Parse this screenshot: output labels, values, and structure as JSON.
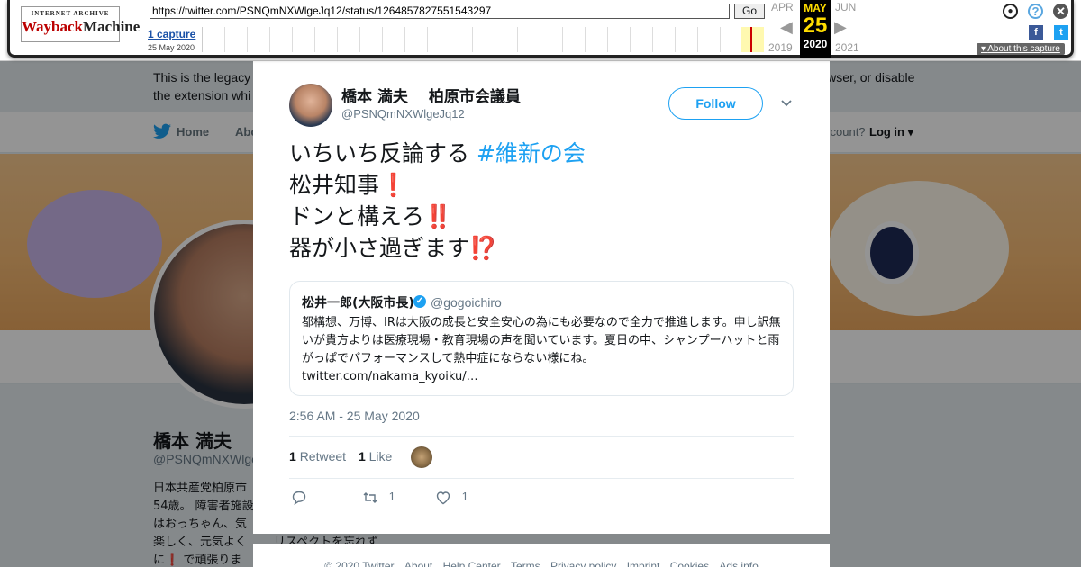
{
  "wayback": {
    "logo_top": "INTERNET ARCHIVE",
    "logo_main_a": "Wayback",
    "logo_main_b": "Machine",
    "url": "https://twitter.com/PSNQmNXWlgeJq12/status/1264857827551543297",
    "go_label": "Go",
    "captures": "1 capture",
    "capture_date": "25 May 2020",
    "prev_month": "APR",
    "cur_month": "MAY",
    "next_month": "JUN",
    "prev_year": "2019",
    "cur_day": "25",
    "cur_year": "2020",
    "next_year": "2021",
    "about": "About this capture"
  },
  "background": {
    "notice_line1": "This is the legacy",
    "notice_line1_end": "wser, or disable",
    "notice_line2": "the extension whi",
    "nav_home": "Home",
    "nav_about": "Abo",
    "login_question": "ccount?",
    "login": "Log in",
    "profile_name": "橋本 満夫",
    "profile_handle": "@PSNQmNXWlge",
    "bio_lines": [
      "日本共産党柏原市",
      "54歳。 障害者施設",
      "はおっちゃん、気",
      "楽しく、元気よく",
      "に❗ で頑張りま"
    ],
    "bio_tail": "リスペクトを忘れず"
  },
  "tweet": {
    "author_name": "橋本 満夫　 柏原市会議員",
    "author_handle": "@PSNQmNXWlgeJq12",
    "follow_label": "Follow",
    "line1_text": "いちいち反論する ",
    "line1_hashtag": "#維新の会",
    "line2_text": "松井知事",
    "line2_emoji": "❗",
    "line3_text": "ドンと構えろ",
    "line3_emoji": "‼️",
    "line4_text": "器が小さ過ぎます",
    "line4_emoji": "⁉️",
    "quote": {
      "name": "松井一郎(大阪市長)",
      "verified_mark": "✓",
      "handle": "@gogoichiro",
      "text": "都構想、万博、IRは大阪の成長と安全安心の為にも必要なので全力で推進します。申し訳無いが貴方よりは医療現場・教育現場の声を聞いています。夏日の中、シャンプーハットと雨がっぱでパフォーマンスして熱中症にならない様にね。",
      "link": "twitter.com/nakama_kyoiku/…"
    },
    "timestamp": "2:56 AM - 25 May 2020",
    "retweet_count": "1",
    "retweet_label": "Retweet",
    "like_count": "1",
    "like_label": "Like",
    "action_retweet_count": "1",
    "action_like_count": "1"
  },
  "footer": {
    "items": [
      "© 2020 Twitter",
      "About",
      "Help Center",
      "Terms",
      "Privacy policy",
      "Imprint",
      "Cookies",
      "Ads info"
    ]
  },
  "colors": {
    "twitter_blue": "#1da1f2",
    "wayback_yellow": "#ffdd00",
    "emoji_red": "#d0102a"
  }
}
